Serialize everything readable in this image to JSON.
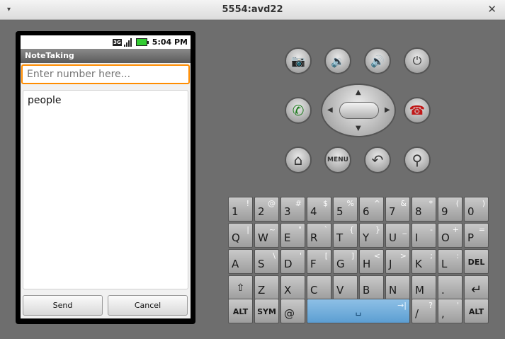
{
  "window": {
    "title": "5554:avd22",
    "menu_glyph": "▾",
    "close_glyph": "✕"
  },
  "status_bar": {
    "network": "3G",
    "time": "5:04 PM"
  },
  "app": {
    "title": "NoteTaking",
    "number_placeholder": "Enter number here...",
    "note_text": "people",
    "send_label": "Send",
    "cancel_label": "Cancel"
  },
  "controls": {
    "camera": "📷",
    "volume_down": "🔉",
    "volume_up": "🔊",
    "power": "⏻",
    "call": "✆",
    "end_call": "☎",
    "home": "⌂",
    "menu": "MENU",
    "back": "↶",
    "search": "⚲"
  },
  "keyboard": {
    "row1": [
      {
        "main": "1",
        "alt": "!"
      },
      {
        "main": "2",
        "alt": "@"
      },
      {
        "main": "3",
        "alt": "#"
      },
      {
        "main": "4",
        "alt": "$"
      },
      {
        "main": "5",
        "alt": "%"
      },
      {
        "main": "6",
        "alt": "^"
      },
      {
        "main": "7",
        "alt": "&"
      },
      {
        "main": "8",
        "alt": "*"
      },
      {
        "main": "9",
        "alt": "("
      },
      {
        "main": "0",
        "alt": ")"
      }
    ],
    "row2": [
      {
        "main": "Q",
        "alt": "|"
      },
      {
        "main": "W",
        "alt": "~"
      },
      {
        "main": "E",
        "alt": "\""
      },
      {
        "main": "R",
        "alt": "`"
      },
      {
        "main": "T",
        "alt": "{"
      },
      {
        "main": "Y",
        "alt": "}"
      },
      {
        "main": "U",
        "alt": "_"
      },
      {
        "main": "I",
        "alt": "-"
      },
      {
        "main": "O",
        "alt": "+"
      },
      {
        "main": "P",
        "alt": "="
      }
    ],
    "row3": [
      {
        "main": "A",
        "alt": ""
      },
      {
        "main": "S",
        "alt": "\\"
      },
      {
        "main": "D",
        "alt": "'"
      },
      {
        "main": "F",
        "alt": "["
      },
      {
        "main": "G",
        "alt": "]"
      },
      {
        "main": "H",
        "alt": "<"
      },
      {
        "main": "J",
        "alt": ">"
      },
      {
        "main": "K",
        "alt": ";"
      },
      {
        "main": "L",
        "alt": ":"
      },
      {
        "main": "DEL",
        "alt": ""
      }
    ],
    "row4": [
      {
        "main": "⇧",
        "alt": ""
      },
      {
        "main": "Z",
        "alt": ""
      },
      {
        "main": "X",
        "alt": ""
      },
      {
        "main": "C",
        "alt": ""
      },
      {
        "main": "V",
        "alt": ""
      },
      {
        "main": "B",
        "alt": ""
      },
      {
        "main": "N",
        "alt": ""
      },
      {
        "main": "M",
        "alt": ""
      },
      {
        "main": ".",
        "alt": ""
      },
      {
        "main": "↵",
        "alt": ""
      }
    ],
    "row5": {
      "alt": "ALT",
      "sym": "SYM",
      "at": "@",
      "space": "␣",
      "space_arrow": "→|",
      "slash": "/",
      "slash_alt": "?",
      "comma": ",",
      "comma_alt": "'",
      "alt_right": "ALT"
    }
  }
}
